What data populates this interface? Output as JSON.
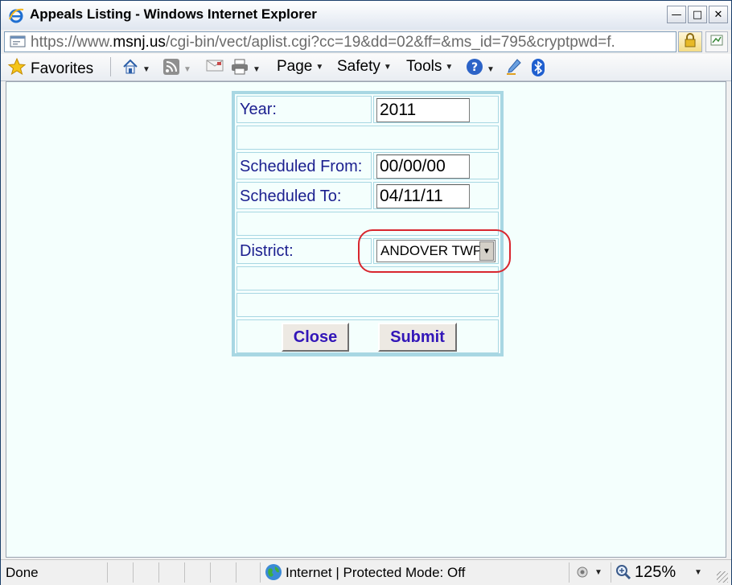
{
  "window": {
    "title": "Appeals Listing - Windows Internet Explorer",
    "minimize_glyph": "—",
    "maximize_glyph": "□",
    "close_glyph": "✕"
  },
  "address": {
    "scheme": "https://www.",
    "host": "msnj.us",
    "path": "/cgi-bin/vect/aplist.cgi?cc=19&dd=02&ff=&ms_id=795&cryptpwd=f."
  },
  "toolbar": {
    "favorites_label": "Favorites",
    "page_label": "Page",
    "safety_label": "Safety",
    "tools_label": "Tools"
  },
  "form": {
    "year_label": "Year:",
    "year_value": "2011",
    "from_label": "Scheduled From:",
    "from_value": "00/00/00",
    "to_label": "Scheduled To:",
    "to_value": "04/11/11",
    "district_label": "District:",
    "district_value": "ANDOVER TWP",
    "close_label": "Close",
    "submit_label": "Submit"
  },
  "status": {
    "text": "Done",
    "zone": "Internet | Protected Mode: Off",
    "zoom": "125%"
  },
  "colors": {
    "form_border": "#a8d7e3",
    "label_text": "#1b1f8f",
    "button_text": "#3216b8",
    "highlight": "#d8262e",
    "page_background": "#f4fffd"
  }
}
